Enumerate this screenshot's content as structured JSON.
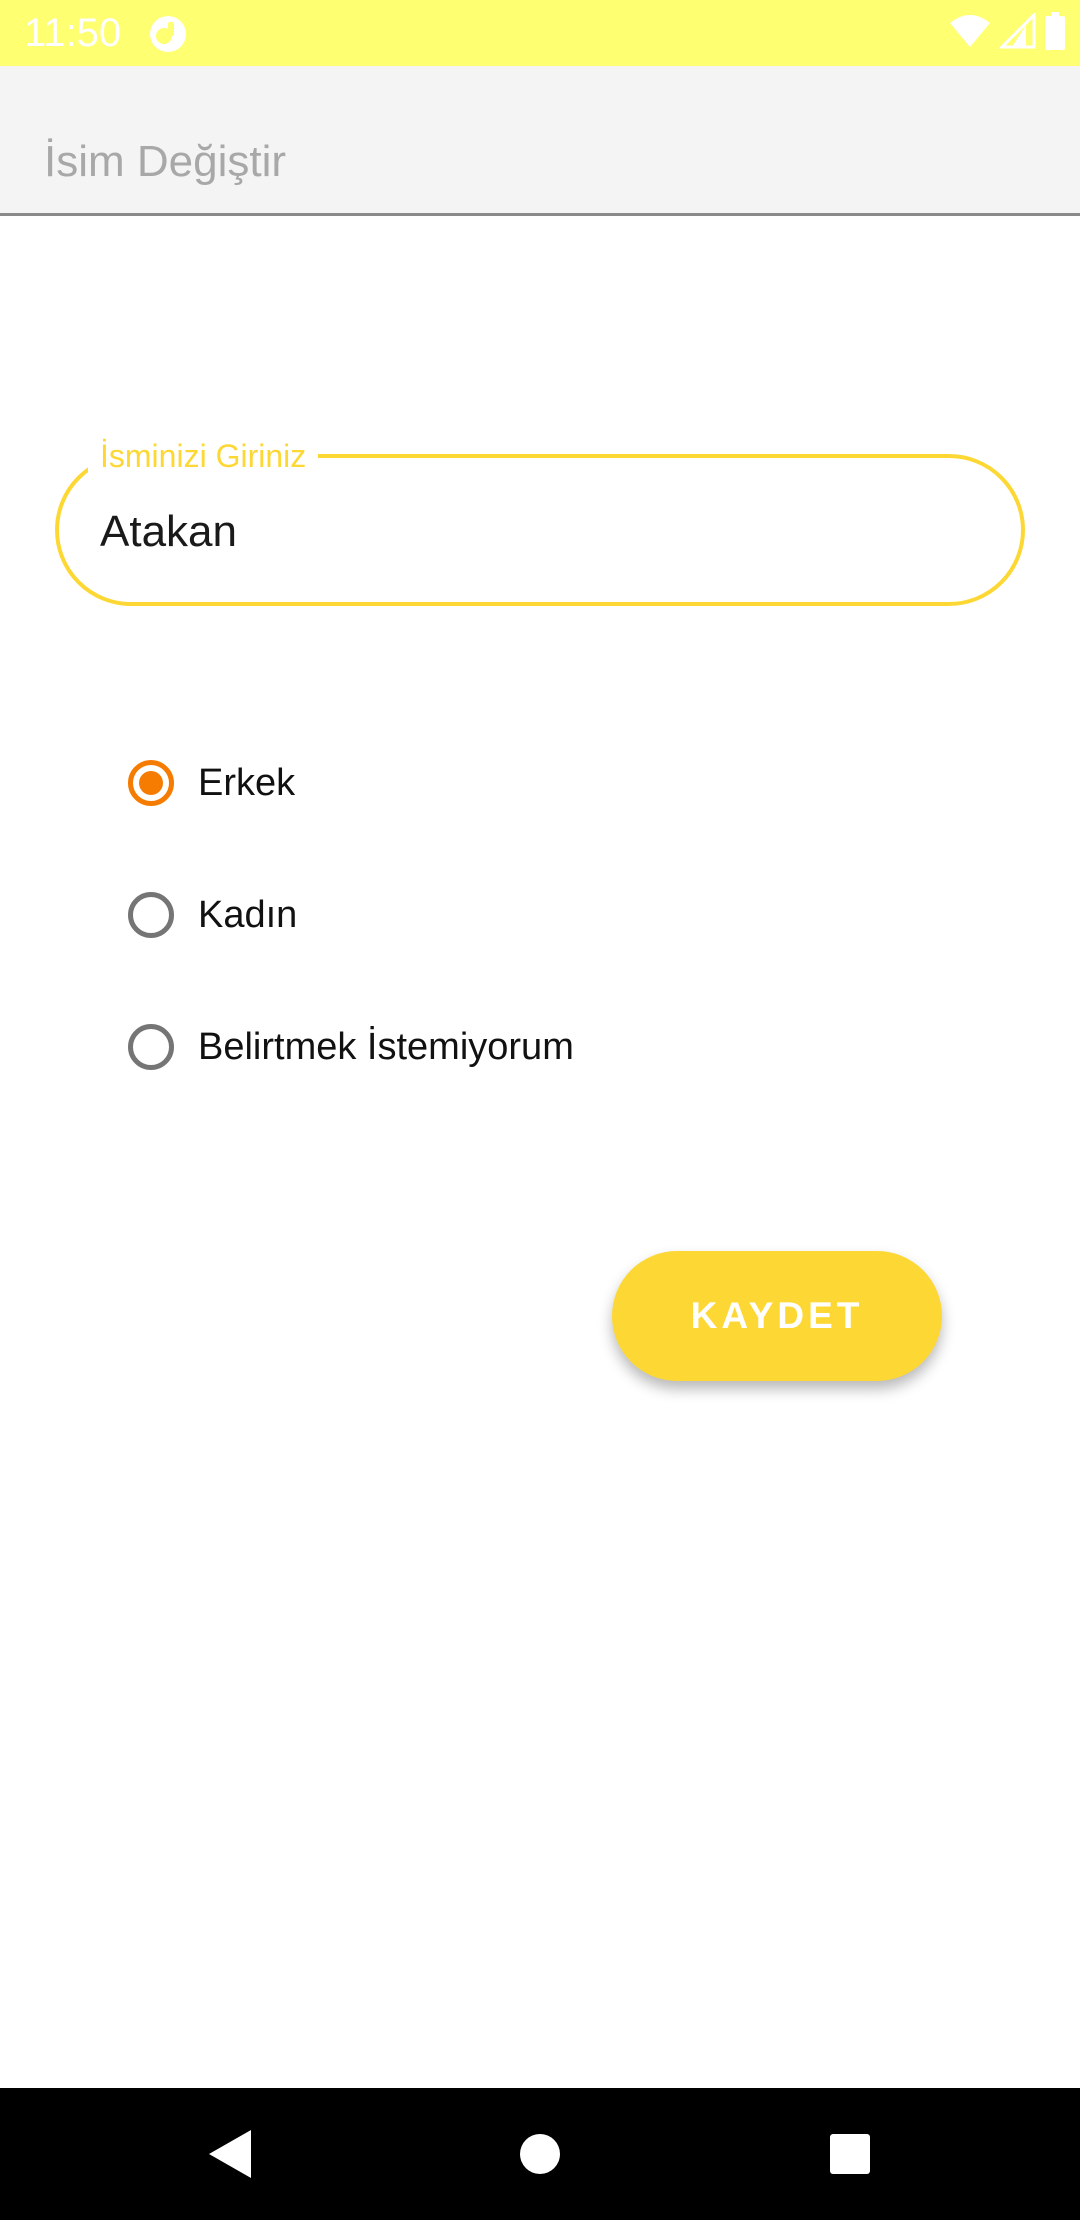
{
  "status_bar": {
    "time": "11:50",
    "background_color": "#ffff72",
    "icons": [
      "app-notification-icon",
      "wifi-icon",
      "signal-icon",
      "battery-icon"
    ]
  },
  "app_bar": {
    "title": "İsim Değiştir"
  },
  "name_field": {
    "label": "İsminizi Giriniz",
    "value": "Atakan",
    "accent_color": "#fdd835"
  },
  "gender_options": [
    {
      "label": "Erkek",
      "checked": true
    },
    {
      "label": "Kadın",
      "checked": false
    },
    {
      "label": "Belirtmek İstemiyorum",
      "checked": false
    }
  ],
  "radio_accent_color": "#f57c00",
  "save_button": {
    "label": "KAYDET",
    "color": "#fdd835"
  },
  "nav_bar": {
    "icons": [
      "back-icon",
      "home-icon",
      "recents-icon"
    ]
  }
}
